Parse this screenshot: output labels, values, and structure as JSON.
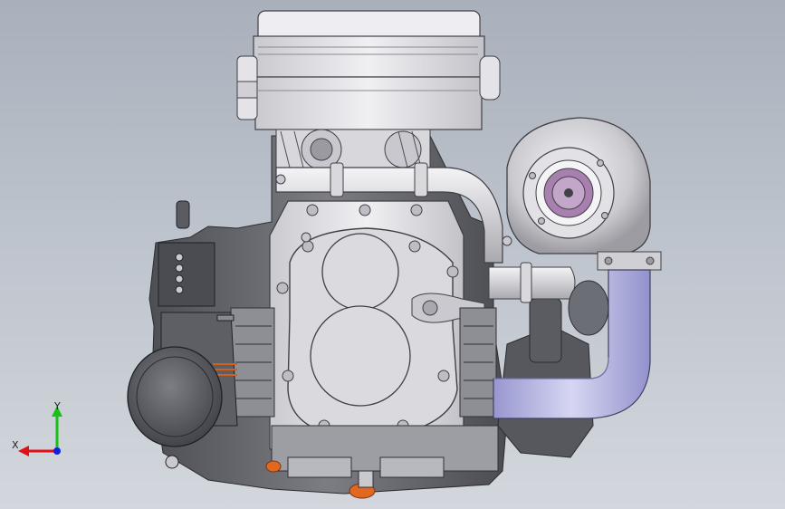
{
  "viewport": {
    "background_top": "#a9b0bb",
    "background_bottom": "#d3d7dd"
  },
  "model": {
    "body_color": "#e6e6ea",
    "dark_color": "#5f6166",
    "pipe_color": "#b9b9e6",
    "accent_color": "#e06820",
    "compressor_wheel_color": "#a880b0"
  },
  "triad": {
    "x_label": "X",
    "y_label": "Y",
    "x_color": "#e0101a",
    "y_color": "#18c018",
    "z_color": "#1020e0"
  }
}
